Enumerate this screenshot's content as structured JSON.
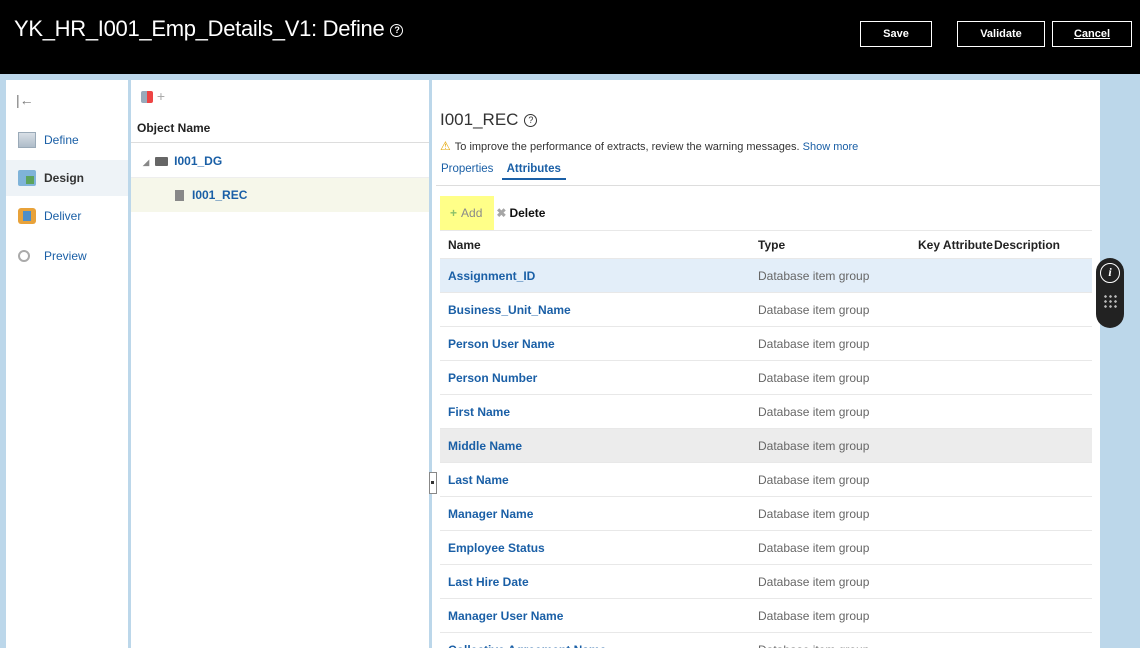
{
  "header": {
    "title": "YK_HR_I001_Emp_Details_V1: Define",
    "help_icon": "?",
    "buttons": {
      "save": "Save",
      "validate": "Validate",
      "cancel": "Cancel"
    }
  },
  "leftnav": {
    "collapse_icon": "|←",
    "items": [
      {
        "label": "Define",
        "icon": "define-icon",
        "active": false
      },
      {
        "label": "Design",
        "icon": "design-icon",
        "active": true
      },
      {
        "label": "Deliver",
        "icon": "deliver-icon",
        "active": false
      },
      {
        "label": "Preview",
        "icon": "preview-icon",
        "active": false
      }
    ]
  },
  "tree": {
    "add_icon": "+",
    "header": "Object Name",
    "nodes": [
      {
        "label": "I001_DG",
        "type": "folder"
      },
      {
        "label": "I001_REC",
        "type": "record",
        "selected": true
      }
    ]
  },
  "content": {
    "record_title": "I001_REC",
    "help_icon": "?",
    "warning": {
      "icon": "⚠",
      "text": "To improve the performance of extracts, review the warning messages.",
      "link": "Show more"
    },
    "tabs": [
      {
        "label": "Properties",
        "active": false
      },
      {
        "label": "Attributes",
        "active": true
      }
    ],
    "toolbar": {
      "add": "Add",
      "delete": "Delete"
    },
    "table": {
      "columns": [
        "Name",
        "Type",
        "Key Attribute",
        "Description"
      ],
      "rows": [
        {
          "name": "Assignment_ID",
          "type": "Database item group"
        },
        {
          "name": "Business_Unit_Name",
          "type": "Database item group"
        },
        {
          "name": "Person User Name",
          "type": "Database item group"
        },
        {
          "name": "Person Number",
          "type": "Database item group"
        },
        {
          "name": "First Name",
          "type": "Database item group"
        },
        {
          "name": "Middle Name",
          "type": "Database item group"
        },
        {
          "name": "Last Name",
          "type": "Database item group"
        },
        {
          "name": "Manager Name",
          "type": "Database item group"
        },
        {
          "name": "Employee Status",
          "type": "Database item group"
        },
        {
          "name": "Last Hire Date",
          "type": "Database item group"
        },
        {
          "name": "Manager User Name",
          "type": "Database item group"
        },
        {
          "name": "Collective Agreement Name",
          "type": "Database item group"
        }
      ]
    }
  },
  "colors": {
    "header_bg": "#000000",
    "link": "#1a5fa6",
    "page_bg": "#bcd7ea",
    "add_highlight": "#ffff88",
    "selected_row": "#e3eef9"
  }
}
